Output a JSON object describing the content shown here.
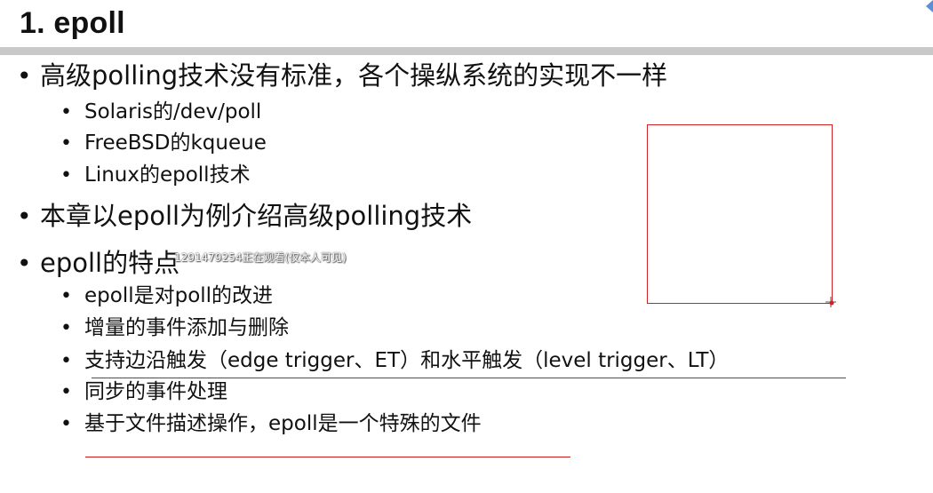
{
  "slide": {
    "title": "1. epoll",
    "bullets": [
      {
        "text": "高级polling技术没有标准，各个操纵系统的实现不一样"
      },
      {
        "text": "Solaris的/dev/poll"
      },
      {
        "text": "FreeBSD的kqueue"
      },
      {
        "text": "Linux的epoll技术"
      },
      {
        "text": "本章以epoll为例介绍高级polling技术"
      },
      {
        "text": "epoll的特点"
      },
      {
        "text": "epoll是对poll的改进"
      },
      {
        "text": "增量的事件添加与删除"
      },
      {
        "text": "支持边沿触发（edge trigger、ET）和水平触发（level trigger、LT）"
      },
      {
        "text": "同步的事件处理"
      },
      {
        "text": "基于文件描述操作，epoll是一个特殊的文件"
      }
    ],
    "bullet_glyph": "•"
  },
  "overlay": {
    "watermark": "1291479254正在观看(仅本人可见)"
  },
  "annotations": {
    "color": "#d42020"
  }
}
